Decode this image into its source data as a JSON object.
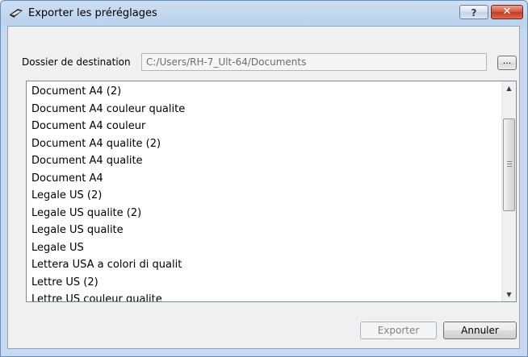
{
  "window": {
    "title": "Exporter les préréglages",
    "help_label": "?",
    "close_label": "✕"
  },
  "destination": {
    "label": "Dossier de destination",
    "path": "C:/Users/RH-7_Ult-64/Documents",
    "browse_label": "..."
  },
  "presets": [
    "Document A4 (2)",
    "Document A4 couleur qualite",
    "Document A4 couleur",
    "Document A4 qualite (2)",
    "Document A4 qualite",
    "Document A4",
    "Legale US  (2)",
    "Legale US qualite (2)",
    "Legale US qualite",
    "Legale US",
    "Lettera USA a colori di qualit",
    "Lettre US (2)",
    "Lettre US couleur qualite"
  ],
  "buttons": {
    "export_label": "Exporter",
    "cancel_label": "Annuler"
  },
  "colors": {
    "title_bar": "#bcd3ee",
    "close_button": "#c23b22",
    "client_background": "#f0f0f0"
  }
}
